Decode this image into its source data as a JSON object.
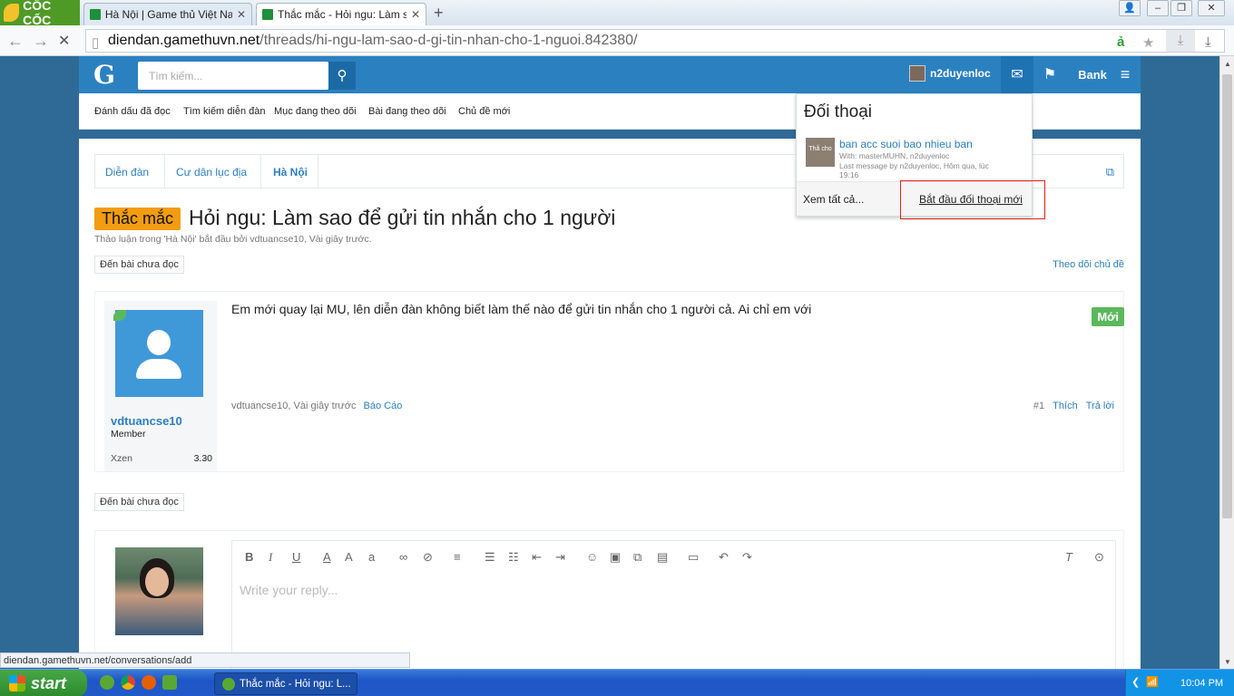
{
  "browser": {
    "brand": "CỐC CỐC",
    "tabs": [
      {
        "label": "Hà Nội | Game thủ Việt Nam - I"
      },
      {
        "label": "Thắc mắc - Hỏi ngu: Làm sao"
      }
    ],
    "url_host": "diendan.gamethuvn.net",
    "url_path": "/threads/hi-ngu-lam-sao-d-gi-tin-nhan-cho-1-nguoi.842380/",
    "status_url": "diendan.gamethuvn.net/conversations/add"
  },
  "header": {
    "logo": "G",
    "search_placeholder": "Tìm kiếm...",
    "username": "n2duyenloc",
    "bank_label": "Bank"
  },
  "subnav": {
    "items": [
      "Đánh dấu đã đọc",
      "Tìm kiếm diễn đàn",
      "Mục đang theo dõi",
      "Bài đang theo dõi",
      "Chủ đề mới"
    ]
  },
  "breadcrumb": [
    "Diễn đàn",
    "Cư dân lục địa",
    "Hà Nội"
  ],
  "thread": {
    "prefix": "Thắc mắc",
    "title": "Hỏi ngu: Làm sao để gửi tin nhắn cho 1 người",
    "meta": "Thảo luận trong 'Hà Nội' bắt đầu bởi vdtuancse10, Vài giây trước.",
    "unread_button": "Đến bài chưa đọc",
    "follow_link": "Theo dõi chủ đề"
  },
  "post": {
    "author": "vdtuancse10",
    "role": "Member",
    "stat_label": "Xzen",
    "stat_value": "3.30",
    "message": "Em mới quay lại MU, lên diễn đàn không biết làm thế nào để gửi tin nhắn cho 1 người cả. Ai chỉ em với",
    "new_badge": "Mới",
    "footer_meta": "vdtuancse10, Vài giây trước",
    "report": "Báo Cáo",
    "number": "#1",
    "like": "Thích",
    "reply": "Trả lời"
  },
  "reply_box": {
    "placeholder": "Write your reply..."
  },
  "conversations_popup": {
    "title": "Đối thoại",
    "item": {
      "title": "ban acc suoi bao nhieu ban",
      "with": "With: masterMUHN, n2duyenloc",
      "last_message": "Last message by n2duyenloc, Hôm qua, lúc",
      "time": "19:16"
    },
    "view_all": "Xem tất cả...",
    "start_new": "Bắt đầu đối thoại mới"
  },
  "taskbar": {
    "start": "start",
    "active_window": "Thắc mắc - Hỏi ngu: L...",
    "clock": "10:04 PM"
  },
  "colors": {
    "header_blue": "#2b81c0",
    "page_bg": "#2f6a96",
    "prefix_orange": "#f39c12",
    "new_green": "#5cb85c",
    "highlight_red": "#e0201a"
  }
}
